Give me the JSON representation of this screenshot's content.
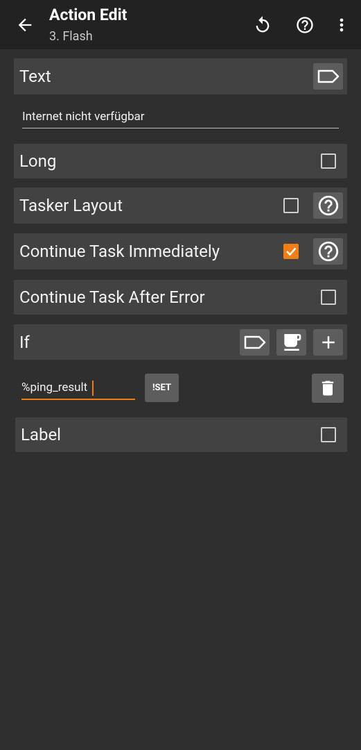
{
  "header": {
    "title": "Action Edit",
    "subtitle": "3. Flash",
    "icons": [
      "back-arrow-icon",
      "reset-icon",
      "help-icon",
      "more-vert-icon"
    ]
  },
  "text_param": {
    "label": "Text",
    "value": "Internet nicht verfügbar"
  },
  "options": {
    "long": {
      "label": "Long",
      "checked": false
    },
    "tasker_layout": {
      "label": "Tasker Layout",
      "checked": false
    },
    "continue_immediately": {
      "label": "Continue Task Immediately",
      "checked": true
    },
    "continue_after_error": {
      "label": "Continue Task After Error",
      "checked": false
    },
    "label_opt": {
      "label": "Label",
      "checked": false
    }
  },
  "condition": {
    "label": "If",
    "variable": "%ping_result",
    "operator": "!SET"
  },
  "colors": {
    "accent": "#f07e12",
    "background": "#2f2f2f",
    "row": "#424242",
    "appbar": "#222222"
  }
}
